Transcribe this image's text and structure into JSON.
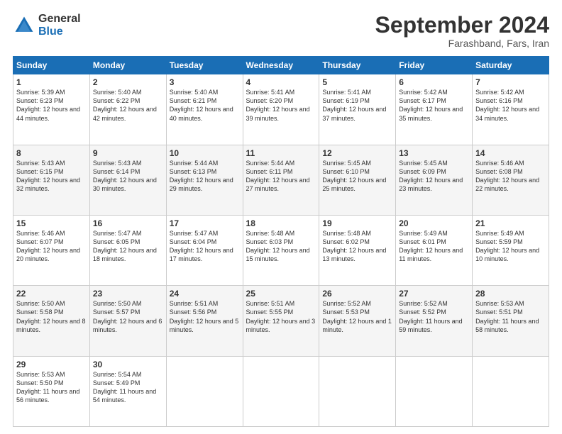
{
  "header": {
    "logo_general": "General",
    "logo_blue": "Blue",
    "month": "September 2024",
    "location": "Farashband, Fars, Iran"
  },
  "days_of_week": [
    "Sunday",
    "Monday",
    "Tuesday",
    "Wednesday",
    "Thursday",
    "Friday",
    "Saturday"
  ],
  "weeks": [
    [
      {
        "num": "1",
        "sunrise": "Sunrise: 5:39 AM",
        "sunset": "Sunset: 6:23 PM",
        "daylight": "Daylight: 12 hours and 44 minutes."
      },
      {
        "num": "2",
        "sunrise": "Sunrise: 5:40 AM",
        "sunset": "Sunset: 6:22 PM",
        "daylight": "Daylight: 12 hours and 42 minutes."
      },
      {
        "num": "3",
        "sunrise": "Sunrise: 5:40 AM",
        "sunset": "Sunset: 6:21 PM",
        "daylight": "Daylight: 12 hours and 40 minutes."
      },
      {
        "num": "4",
        "sunrise": "Sunrise: 5:41 AM",
        "sunset": "Sunset: 6:20 PM",
        "daylight": "Daylight: 12 hours and 39 minutes."
      },
      {
        "num": "5",
        "sunrise": "Sunrise: 5:41 AM",
        "sunset": "Sunset: 6:19 PM",
        "daylight": "Daylight: 12 hours and 37 minutes."
      },
      {
        "num": "6",
        "sunrise": "Sunrise: 5:42 AM",
        "sunset": "Sunset: 6:17 PM",
        "daylight": "Daylight: 12 hours and 35 minutes."
      },
      {
        "num": "7",
        "sunrise": "Sunrise: 5:42 AM",
        "sunset": "Sunset: 6:16 PM",
        "daylight": "Daylight: 12 hours and 34 minutes."
      }
    ],
    [
      {
        "num": "8",
        "sunrise": "Sunrise: 5:43 AM",
        "sunset": "Sunset: 6:15 PM",
        "daylight": "Daylight: 12 hours and 32 minutes."
      },
      {
        "num": "9",
        "sunrise": "Sunrise: 5:43 AM",
        "sunset": "Sunset: 6:14 PM",
        "daylight": "Daylight: 12 hours and 30 minutes."
      },
      {
        "num": "10",
        "sunrise": "Sunrise: 5:44 AM",
        "sunset": "Sunset: 6:13 PM",
        "daylight": "Daylight: 12 hours and 29 minutes."
      },
      {
        "num": "11",
        "sunrise": "Sunrise: 5:44 AM",
        "sunset": "Sunset: 6:11 PM",
        "daylight": "Daylight: 12 hours and 27 minutes."
      },
      {
        "num": "12",
        "sunrise": "Sunrise: 5:45 AM",
        "sunset": "Sunset: 6:10 PM",
        "daylight": "Daylight: 12 hours and 25 minutes."
      },
      {
        "num": "13",
        "sunrise": "Sunrise: 5:45 AM",
        "sunset": "Sunset: 6:09 PM",
        "daylight": "Daylight: 12 hours and 23 minutes."
      },
      {
        "num": "14",
        "sunrise": "Sunrise: 5:46 AM",
        "sunset": "Sunset: 6:08 PM",
        "daylight": "Daylight: 12 hours and 22 minutes."
      }
    ],
    [
      {
        "num": "15",
        "sunrise": "Sunrise: 5:46 AM",
        "sunset": "Sunset: 6:07 PM",
        "daylight": "Daylight: 12 hours and 20 minutes."
      },
      {
        "num": "16",
        "sunrise": "Sunrise: 5:47 AM",
        "sunset": "Sunset: 6:05 PM",
        "daylight": "Daylight: 12 hours and 18 minutes."
      },
      {
        "num": "17",
        "sunrise": "Sunrise: 5:47 AM",
        "sunset": "Sunset: 6:04 PM",
        "daylight": "Daylight: 12 hours and 17 minutes."
      },
      {
        "num": "18",
        "sunrise": "Sunrise: 5:48 AM",
        "sunset": "Sunset: 6:03 PM",
        "daylight": "Daylight: 12 hours and 15 minutes."
      },
      {
        "num": "19",
        "sunrise": "Sunrise: 5:48 AM",
        "sunset": "Sunset: 6:02 PM",
        "daylight": "Daylight: 12 hours and 13 minutes."
      },
      {
        "num": "20",
        "sunrise": "Sunrise: 5:49 AM",
        "sunset": "Sunset: 6:01 PM",
        "daylight": "Daylight: 12 hours and 11 minutes."
      },
      {
        "num": "21",
        "sunrise": "Sunrise: 5:49 AM",
        "sunset": "Sunset: 5:59 PM",
        "daylight": "Daylight: 12 hours and 10 minutes."
      }
    ],
    [
      {
        "num": "22",
        "sunrise": "Sunrise: 5:50 AM",
        "sunset": "Sunset: 5:58 PM",
        "daylight": "Daylight: 12 hours and 8 minutes."
      },
      {
        "num": "23",
        "sunrise": "Sunrise: 5:50 AM",
        "sunset": "Sunset: 5:57 PM",
        "daylight": "Daylight: 12 hours and 6 minutes."
      },
      {
        "num": "24",
        "sunrise": "Sunrise: 5:51 AM",
        "sunset": "Sunset: 5:56 PM",
        "daylight": "Daylight: 12 hours and 5 minutes."
      },
      {
        "num": "25",
        "sunrise": "Sunrise: 5:51 AM",
        "sunset": "Sunset: 5:55 PM",
        "daylight": "Daylight: 12 hours and 3 minutes."
      },
      {
        "num": "26",
        "sunrise": "Sunrise: 5:52 AM",
        "sunset": "Sunset: 5:53 PM",
        "daylight": "Daylight: 12 hours and 1 minute."
      },
      {
        "num": "27",
        "sunrise": "Sunrise: 5:52 AM",
        "sunset": "Sunset: 5:52 PM",
        "daylight": "Daylight: 11 hours and 59 minutes."
      },
      {
        "num": "28",
        "sunrise": "Sunrise: 5:53 AM",
        "sunset": "Sunset: 5:51 PM",
        "daylight": "Daylight: 11 hours and 58 minutes."
      }
    ],
    [
      {
        "num": "29",
        "sunrise": "Sunrise: 5:53 AM",
        "sunset": "Sunset: 5:50 PM",
        "daylight": "Daylight: 11 hours and 56 minutes."
      },
      {
        "num": "30",
        "sunrise": "Sunrise: 5:54 AM",
        "sunset": "Sunset: 5:49 PM",
        "daylight": "Daylight: 11 hours and 54 minutes."
      },
      null,
      null,
      null,
      null,
      null
    ]
  ]
}
